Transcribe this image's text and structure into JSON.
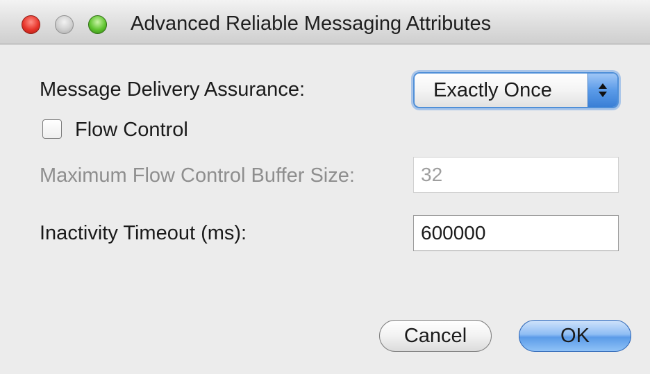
{
  "window": {
    "title": "Advanced Reliable Messaging Attributes",
    "buttons": {
      "close": "close-icon",
      "minimize": "minimize-icon",
      "zoom": "zoom-icon"
    }
  },
  "form": {
    "delivery_label": "Message Delivery Assurance:",
    "delivery_value": "Exactly Once",
    "flow_control_label": "Flow Control",
    "flow_control_checked": false,
    "buffer_label": "Maximum Flow Control Buffer Size:",
    "buffer_value": "32",
    "timeout_label": "Inactivity Timeout (ms):",
    "timeout_value": "600000"
  },
  "actions": {
    "cancel_label": "Cancel",
    "ok_label": "OK"
  },
  "colors": {
    "accent": "#5b9be8",
    "close": "#e7342a",
    "zoom": "#5fc42f",
    "disabled_text": "#8e8e8e"
  }
}
